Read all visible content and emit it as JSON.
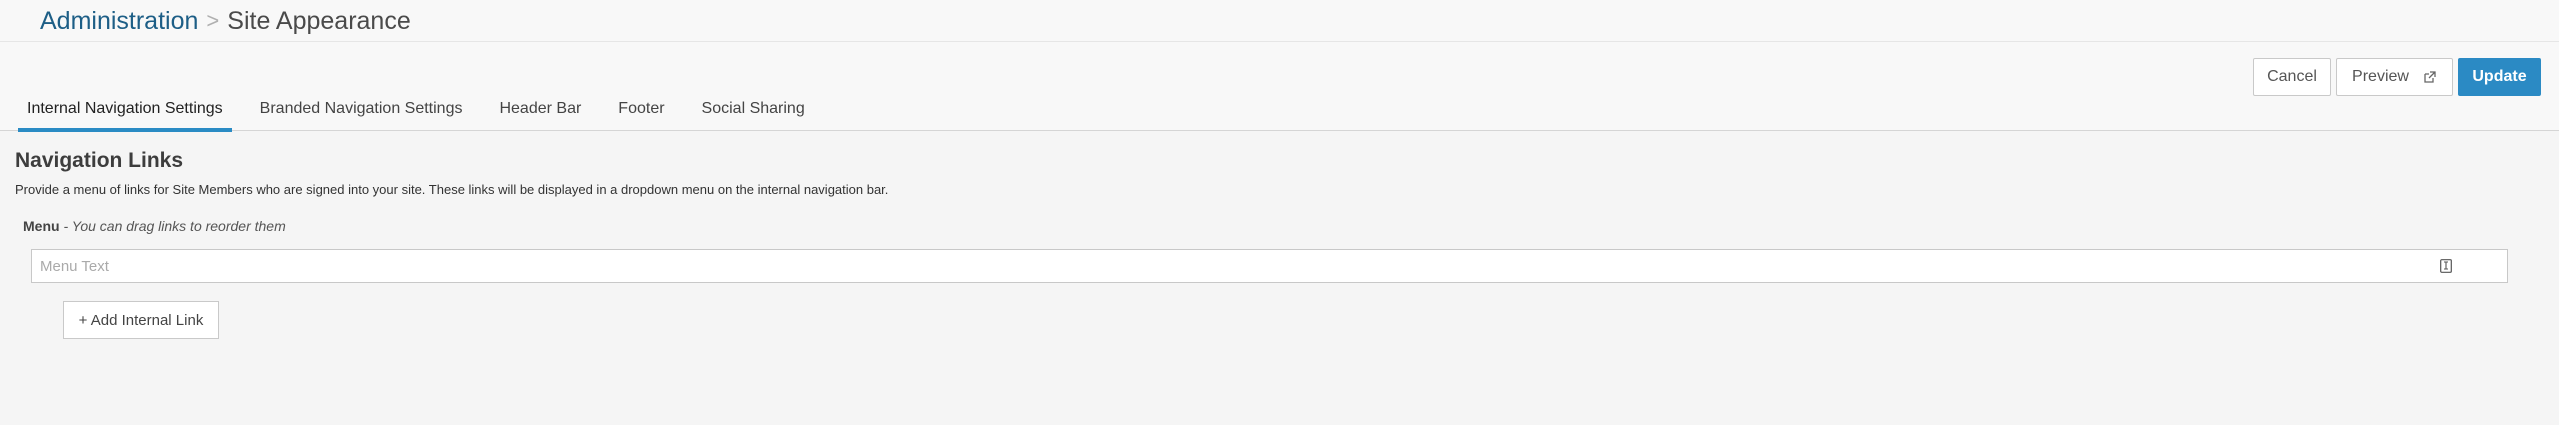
{
  "breadcrumb": {
    "parent": "Administration",
    "separator": ">",
    "current": "Site Appearance"
  },
  "tabs": [
    {
      "label": "Internal Navigation Settings",
      "active": true
    },
    {
      "label": "Branded Navigation Settings",
      "active": false
    },
    {
      "label": "Header Bar",
      "active": false
    },
    {
      "label": "Footer",
      "active": false
    },
    {
      "label": "Social Sharing",
      "active": false
    }
  ],
  "actions": {
    "cancel_label": "Cancel",
    "preview_label": "Preview",
    "preview_icon": "external-link-icon",
    "update_label": "Update"
  },
  "section": {
    "title": "Navigation Links",
    "description": "Provide a menu of links for Site Members who are signed into your site. These links will be displayed in a dropdown menu on the internal navigation bar."
  },
  "menu": {
    "label": "Menu",
    "hint": "- You can drag links to reorder them",
    "input_placeholder": "Menu Text",
    "input_value": "",
    "field_icon": "text-field-icon",
    "add_link_label": "+ Add Internal Link"
  },
  "colors": {
    "accent": "#2b8ac4",
    "breadcrumb_link": "#1d5e86",
    "background": "#f5f5f5"
  }
}
